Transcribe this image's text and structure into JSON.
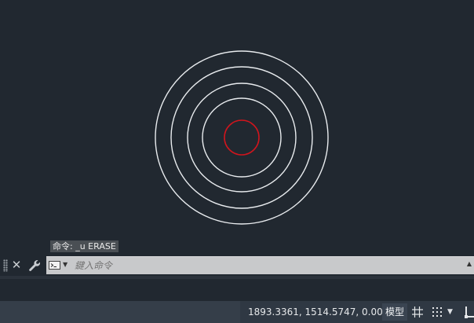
{
  "drawing": {
    "circles_white_count": 4,
    "circle_red_count": 1,
    "colors": {
      "background": "#212830",
      "white_circle": "#e9ecef",
      "red_circle": "#d0151d"
    }
  },
  "command": {
    "history_text": "命令: _u ERASE",
    "placeholder": "鍵入命令",
    "close_icon": "close-icon",
    "customize_icon": "wrench-icon",
    "prompt_icon": "terminal-prompt-icon"
  },
  "status": {
    "coordinates": "1893.3361, 1514.5747, 0.0000",
    "model_label": "模型",
    "grid_icon": "grid-icon",
    "snap_icon": "snap-icon"
  }
}
